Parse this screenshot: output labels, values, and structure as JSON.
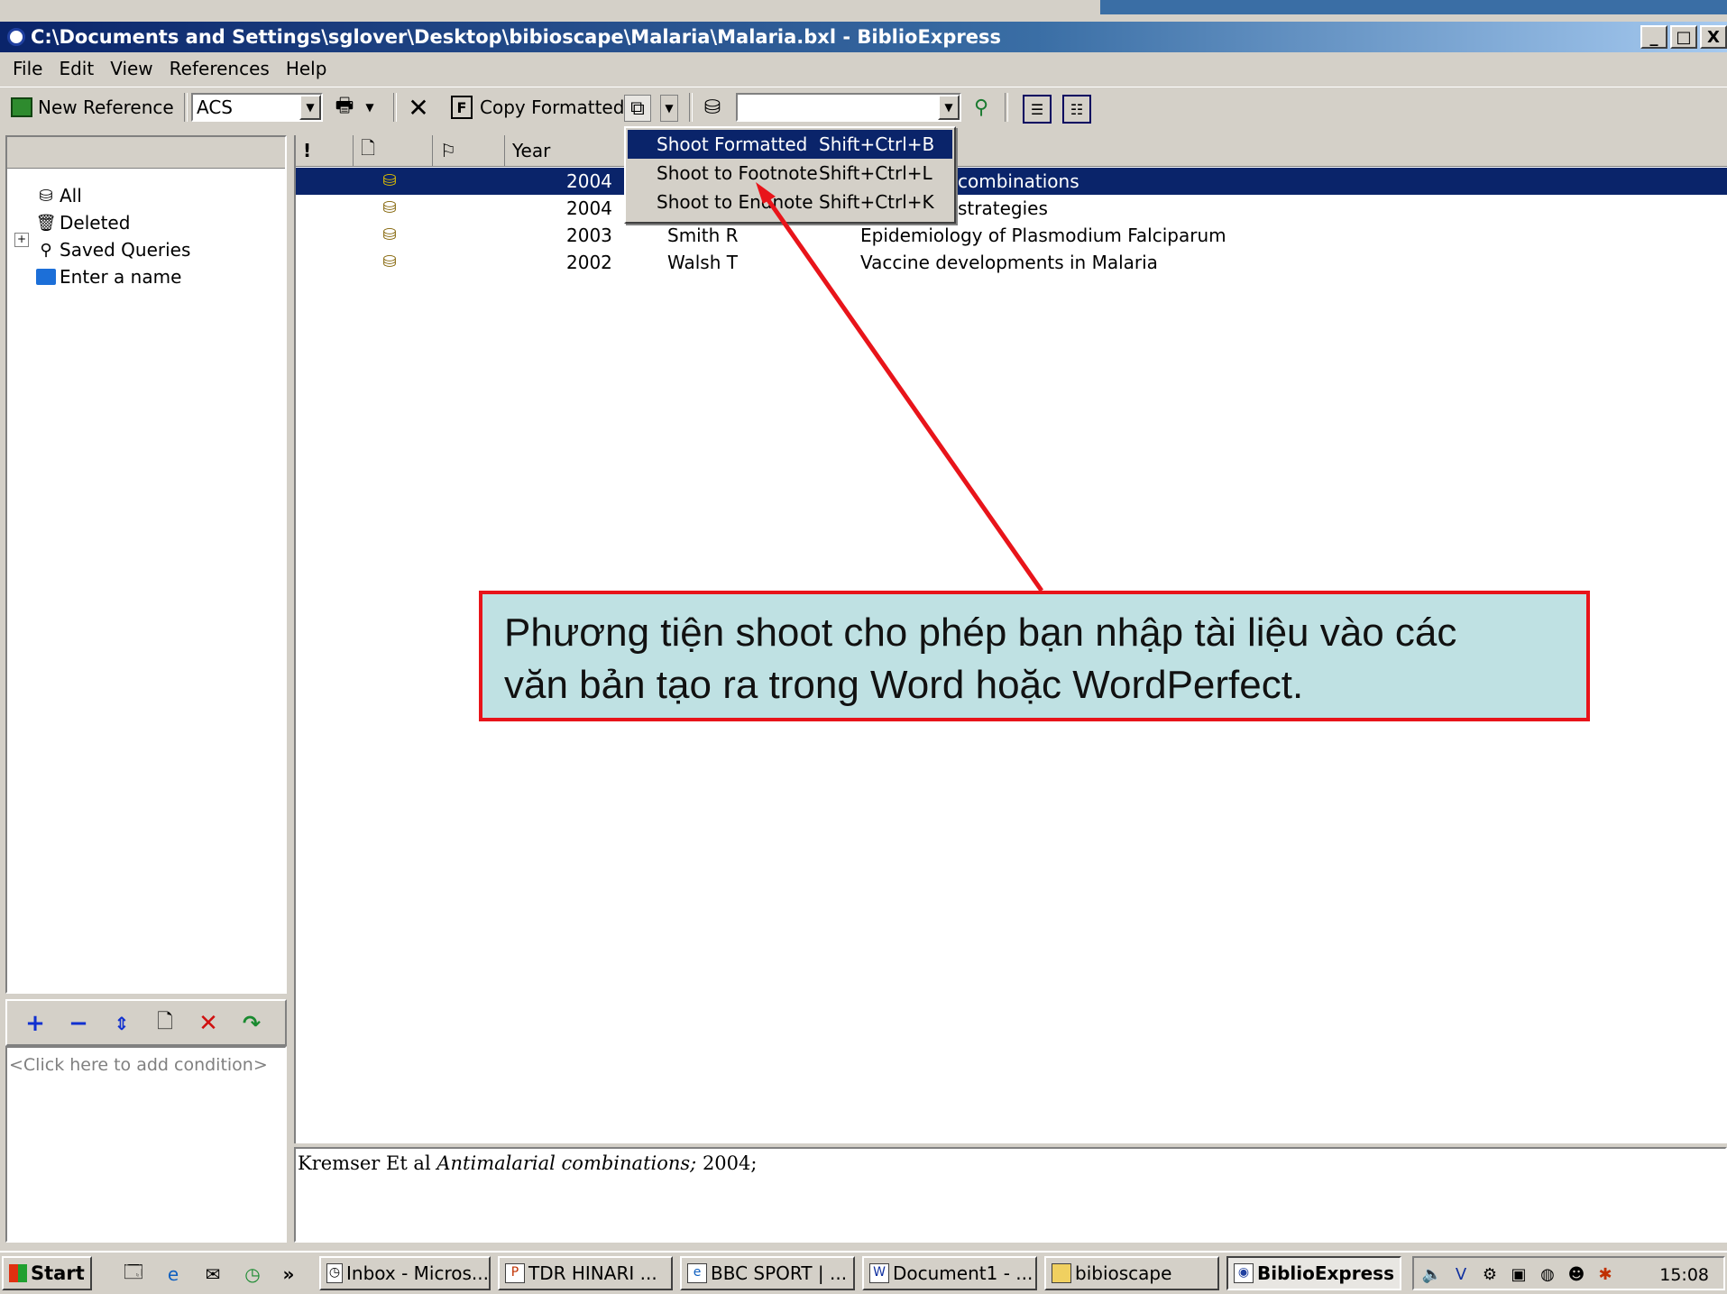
{
  "window": {
    "title": "C:\\Documents and Settings\\sglover\\Desktop\\bibioscape\\Malaria\\Malaria.bxl - BiblioExpress",
    "min": "_",
    "max": "□",
    "close": "X"
  },
  "menu": [
    "File",
    "Edit",
    "View",
    "References",
    "Help"
  ],
  "toolbar": {
    "new_reference": "New Reference",
    "style_value": "ACS",
    "copy_formatted": "Copy Formatted",
    "search_value": ""
  },
  "tree": {
    "items": [
      {
        "label": "All",
        "icon": "library-icon"
      },
      {
        "label": "Deleted",
        "icon": "trash-icon"
      },
      {
        "label": "Saved Queries",
        "icon": "magnifier-icon"
      },
      {
        "label": "Enter a name",
        "icon": "folder-icon"
      }
    ]
  },
  "query": {
    "placeholder": "<Click here to add condition>"
  },
  "list": {
    "headers": {
      "flag": "!",
      "doc": "",
      "attach": "",
      "year": "Year"
    },
    "rows": [
      {
        "year": "2004",
        "author": "",
        "title": "combinations",
        "selected": true
      },
      {
        "year": "2004",
        "author": "",
        "title": "strategies",
        "selected": false
      },
      {
        "year": "2003",
        "author": "Smith R",
        "title": "Epidemiology of Plasmodium Falciparum",
        "selected": false
      },
      {
        "year": "2002",
        "author": "Walsh T",
        "title": "Vaccine developments in Malaria",
        "selected": false
      }
    ]
  },
  "shoot_menu": [
    {
      "label": "Shoot Formatted",
      "shortcut": "Shift+Ctrl+B",
      "highlighted": true
    },
    {
      "label": "Shoot to Footnote",
      "shortcut": "Shift+Ctrl+L",
      "highlighted": false
    },
    {
      "label": "Shoot to Endnote",
      "shortcut": "Shift+Ctrl+K",
      "highlighted": false
    }
  ],
  "preview": {
    "authors": "Kremser Et al",
    "title": "Antimalarial combinations;",
    "year": "2004;"
  },
  "callout": {
    "line1": "Phương tiện shoot cho phép bạn nhập tài liệu vào các",
    "line2": "văn bản tạo ra  trong Word hoặc WordPerfect."
  },
  "taskbar": {
    "start": "Start",
    "more": "»",
    "tasks": [
      {
        "label": "Inbox - Micros...",
        "active": false
      },
      {
        "label": "TDR HINARI ...",
        "active": false
      },
      {
        "label": "BBC SPORT | ...",
        "active": false
      },
      {
        "label": "Document1 - ...",
        "active": false
      },
      {
        "label": "bibioscape",
        "active": false
      },
      {
        "label": "BiblioExpress",
        "active": true
      }
    ],
    "clock": "15:08"
  },
  "colors": {
    "selection": "#0a246a",
    "callout_fill": "#bfe1e3",
    "callout_border": "#e8141a"
  }
}
